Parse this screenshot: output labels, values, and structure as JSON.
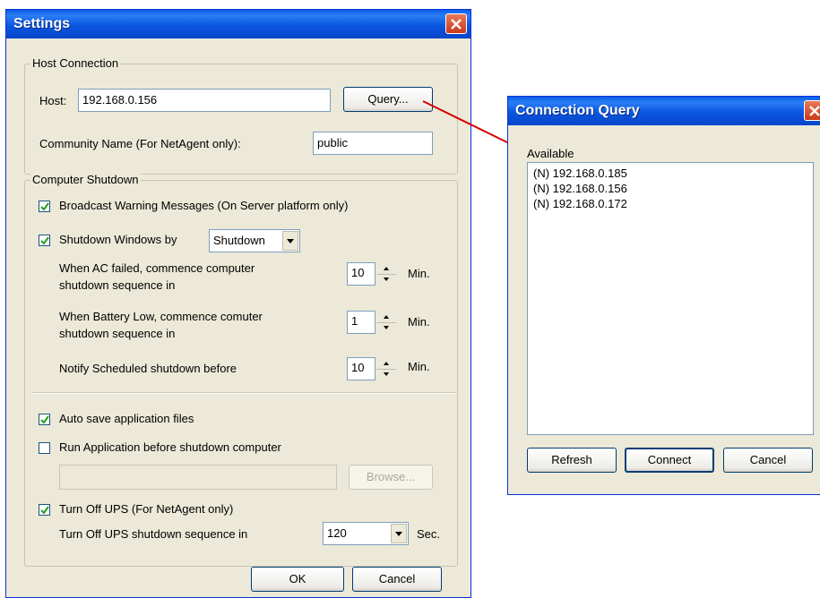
{
  "settings": {
    "title": "Settings",
    "host_connection": {
      "group_label": "Host Connection",
      "host_label": "Host:",
      "host_value": "192.168.0.156",
      "query_button": "Query...",
      "community_label": "Community Name (For NetAgent only):",
      "community_value": "public"
    },
    "computer_shutdown": {
      "group_label": "Computer Shutdown",
      "broadcast_label": "Broadcast Warning Messages (On Server platform only)",
      "broadcast_checked": true,
      "shutdown_windows_label": "Shutdown Windows by",
      "shutdown_windows_checked": true,
      "shutdown_method": "Shutdown",
      "ac_failed_line1": "When AC failed, commence computer",
      "ac_failed_line2": "shutdown sequence in",
      "ac_failed_value": "10",
      "battery_low_line1": "When Battery Low, commence comuter",
      "battery_low_line2": "shutdown sequence in",
      "battery_low_value": "1",
      "notify_label": "Notify Scheduled shutdown before",
      "notify_value": "10",
      "min_unit": "Min."
    },
    "auto_save_label": "Auto save application files",
    "auto_save_checked": true,
    "run_app_label": "Run Application before shutdown computer",
    "run_app_checked": false,
    "run_app_path": "",
    "browse_button": "Browse...",
    "turn_off_ups_label": "Turn Off UPS (For NetAgent only)",
    "turn_off_ups_checked": true,
    "ups_sequence_label": "Turn Off UPS shutdown sequence in",
    "ups_sequence_value": "120",
    "sec_unit": "Sec.",
    "ok_button": "OK",
    "cancel_button": "Cancel"
  },
  "connection_query": {
    "title": "Connection Query",
    "available_label": "Available",
    "items": [
      "(N) 192.168.0.185",
      "(N) 192.168.0.156",
      "(N) 192.168.0.172"
    ],
    "refresh_button": "Refresh",
    "connect_button": "Connect",
    "cancel_button": "Cancel"
  },
  "colors": {
    "titlebar": "#0b56e0",
    "window_face": "#ece9d8",
    "connector_line": "#d40000"
  }
}
